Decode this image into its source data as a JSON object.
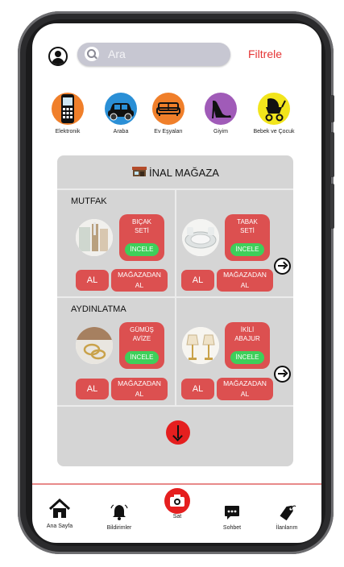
{
  "header": {
    "search_placeholder": "Ara",
    "filter_label": "Filtrele"
  },
  "categories": [
    {
      "label": "Elektronik",
      "icon": "phone-icon",
      "color": "#f07f2a"
    },
    {
      "label": "Araba",
      "icon": "car-icon",
      "color": "#2a8fd6"
    },
    {
      "label": "Ev Eşyaları",
      "icon": "sofa-icon",
      "color": "#f07f2a"
    },
    {
      "label": "Giyim",
      "icon": "high-heel-icon",
      "color": "#a05bb8"
    },
    {
      "label": "Bebek ve Çocuk",
      "icon": "stroller-icon",
      "color": "#f2e51c"
    }
  ],
  "store": {
    "title": "İNAL MAĞAZA",
    "sections": [
      {
        "title": "MUTFAK",
        "items": [
          {
            "name_line1": "BIÇAK",
            "name_line2": "SETİ",
            "inspect": "İNCELE",
            "buy": "AL",
            "store_line1": "MAĞAZADAN",
            "store_line2": "AL"
          },
          {
            "name_line1": "TABAK",
            "name_line2": "SETİ",
            "inspect": "İNCELE",
            "buy": "AL",
            "store_line1": "MAĞAZADAN",
            "store_line2": "AL"
          }
        ]
      },
      {
        "title": "AYDINLATMA",
        "items": [
          {
            "name_line1": "GÜMÜŞ",
            "name_line2": "AVİZE",
            "inspect": "İNCELE",
            "buy": "AL",
            "store_line1": "MAĞAZADAN",
            "store_line2": "AL"
          },
          {
            "name_line1": "İKİLİ",
            "name_line2": "ABAJUR",
            "inspect": "İNCELE",
            "buy": "AL",
            "store_line1": "MAĞAZADAN",
            "store_line2": "AL"
          }
        ]
      }
    ]
  },
  "nav": [
    {
      "label": "Ana Sayfa",
      "icon": "home-icon"
    },
    {
      "label": "Bildirimler",
      "icon": "bell-icon"
    },
    {
      "label": "Sat",
      "icon": "camera-icon"
    },
    {
      "label": "Sohbet",
      "icon": "chat-icon"
    },
    {
      "label": "İlanlarım",
      "icon": "tag-icon"
    }
  ],
  "colors": {
    "accent_red": "#dc5050",
    "inspect_green": "#3ecf5a",
    "filter_red": "#e53535",
    "panel_gray": "#d5d5d5"
  }
}
